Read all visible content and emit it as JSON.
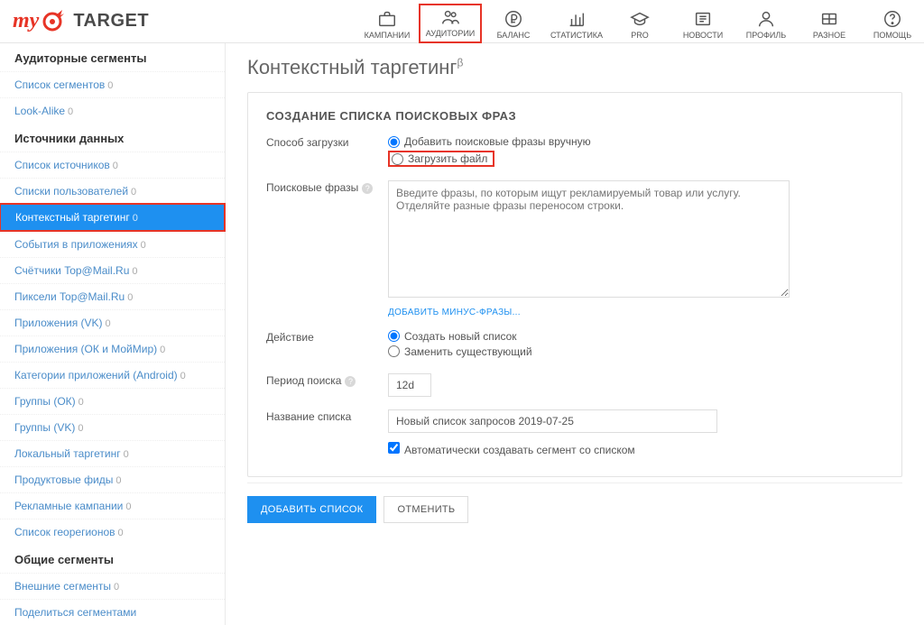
{
  "logo": {
    "my": "my",
    "target": "TARGET"
  },
  "nav": {
    "campaigns": "КАМПАНИИ",
    "audiences": "АУДИТОРИИ",
    "balance": "БАЛАНС",
    "stats": "СТАТИСТИКА",
    "pro": "PRO",
    "news": "НОВОСТИ",
    "profile": "ПРОФИЛЬ",
    "misc": "РАЗНОЕ",
    "help": "ПОМОЩЬ"
  },
  "sidebar": {
    "sec1": "Аудиторные сегменты",
    "seg_list": "Список сегментов",
    "seg_list_n": "0",
    "lookalike": "Look-Alike",
    "lookalike_n": "0",
    "sec2": "Источники данных",
    "src_list": "Список источников",
    "src_list_n": "0",
    "user_lists": "Списки пользователей",
    "user_lists_n": "0",
    "ctx": "Контекстный таргетинг",
    "ctx_n": "0",
    "app_events": "События в приложениях",
    "app_events_n": "0",
    "top_counters": "Счётчики Top@Mail.Ru",
    "top_counters_n": "0",
    "top_pixels": "Пиксели Top@Mail.Ru",
    "top_pixels_n": "0",
    "apps_vk": "Приложения (VK)",
    "apps_vk_n": "0",
    "apps_ok": "Приложения (ОК и МойМир)",
    "apps_ok_n": "0",
    "cat_android": "Категории приложений (Android)",
    "cat_android_n": "0",
    "groups_ok": "Группы (ОК)",
    "groups_ok_n": "0",
    "groups_vk": "Группы (VK)",
    "groups_vk_n": "0",
    "local_trg": "Локальный таргетинг",
    "local_trg_n": "0",
    "feeds": "Продуктовые фиды",
    "feeds_n": "0",
    "adv_camp": "Рекламные кампании",
    "adv_camp_n": "0",
    "georegions": "Список георегионов",
    "georegions_n": "0",
    "sec3": "Общие сегменты",
    "ext_seg": "Внешние сегменты",
    "ext_seg_n": "0",
    "share": "Поделиться сегментами"
  },
  "page_title": "Контекстный таргетинг",
  "panel_title": "СОЗДАНИЕ СПИСКА ПОИСКОВЫХ ФРАЗ",
  "load_method_label": "Способ загрузки",
  "load_manual": "Добавить поисковые фразы вручную",
  "load_file": "Загрузить файл",
  "phrases_label": "Поисковые фразы",
  "phrases_placeholder": "Введите фразы, по которым ищут рекламируемый товар или услугу.\nОтделяйте разные фразы переносом строки.",
  "add_minus": "ДОБАВИТЬ МИНУС-ФРАЗЫ...",
  "action_label": "Действие",
  "action_create": "Создать новый список",
  "action_replace": "Заменить существующий",
  "period_label": "Период поиска",
  "period_value": "12d",
  "listname_label": "Название списка",
  "listname_value": "Новый список запросов 2019-07-25",
  "auto_segment": "Автоматически создавать сегмент со списком",
  "btn_add": "ДОБАВИТЬ СПИСОК",
  "btn_cancel": "ОТМЕНИТЬ"
}
